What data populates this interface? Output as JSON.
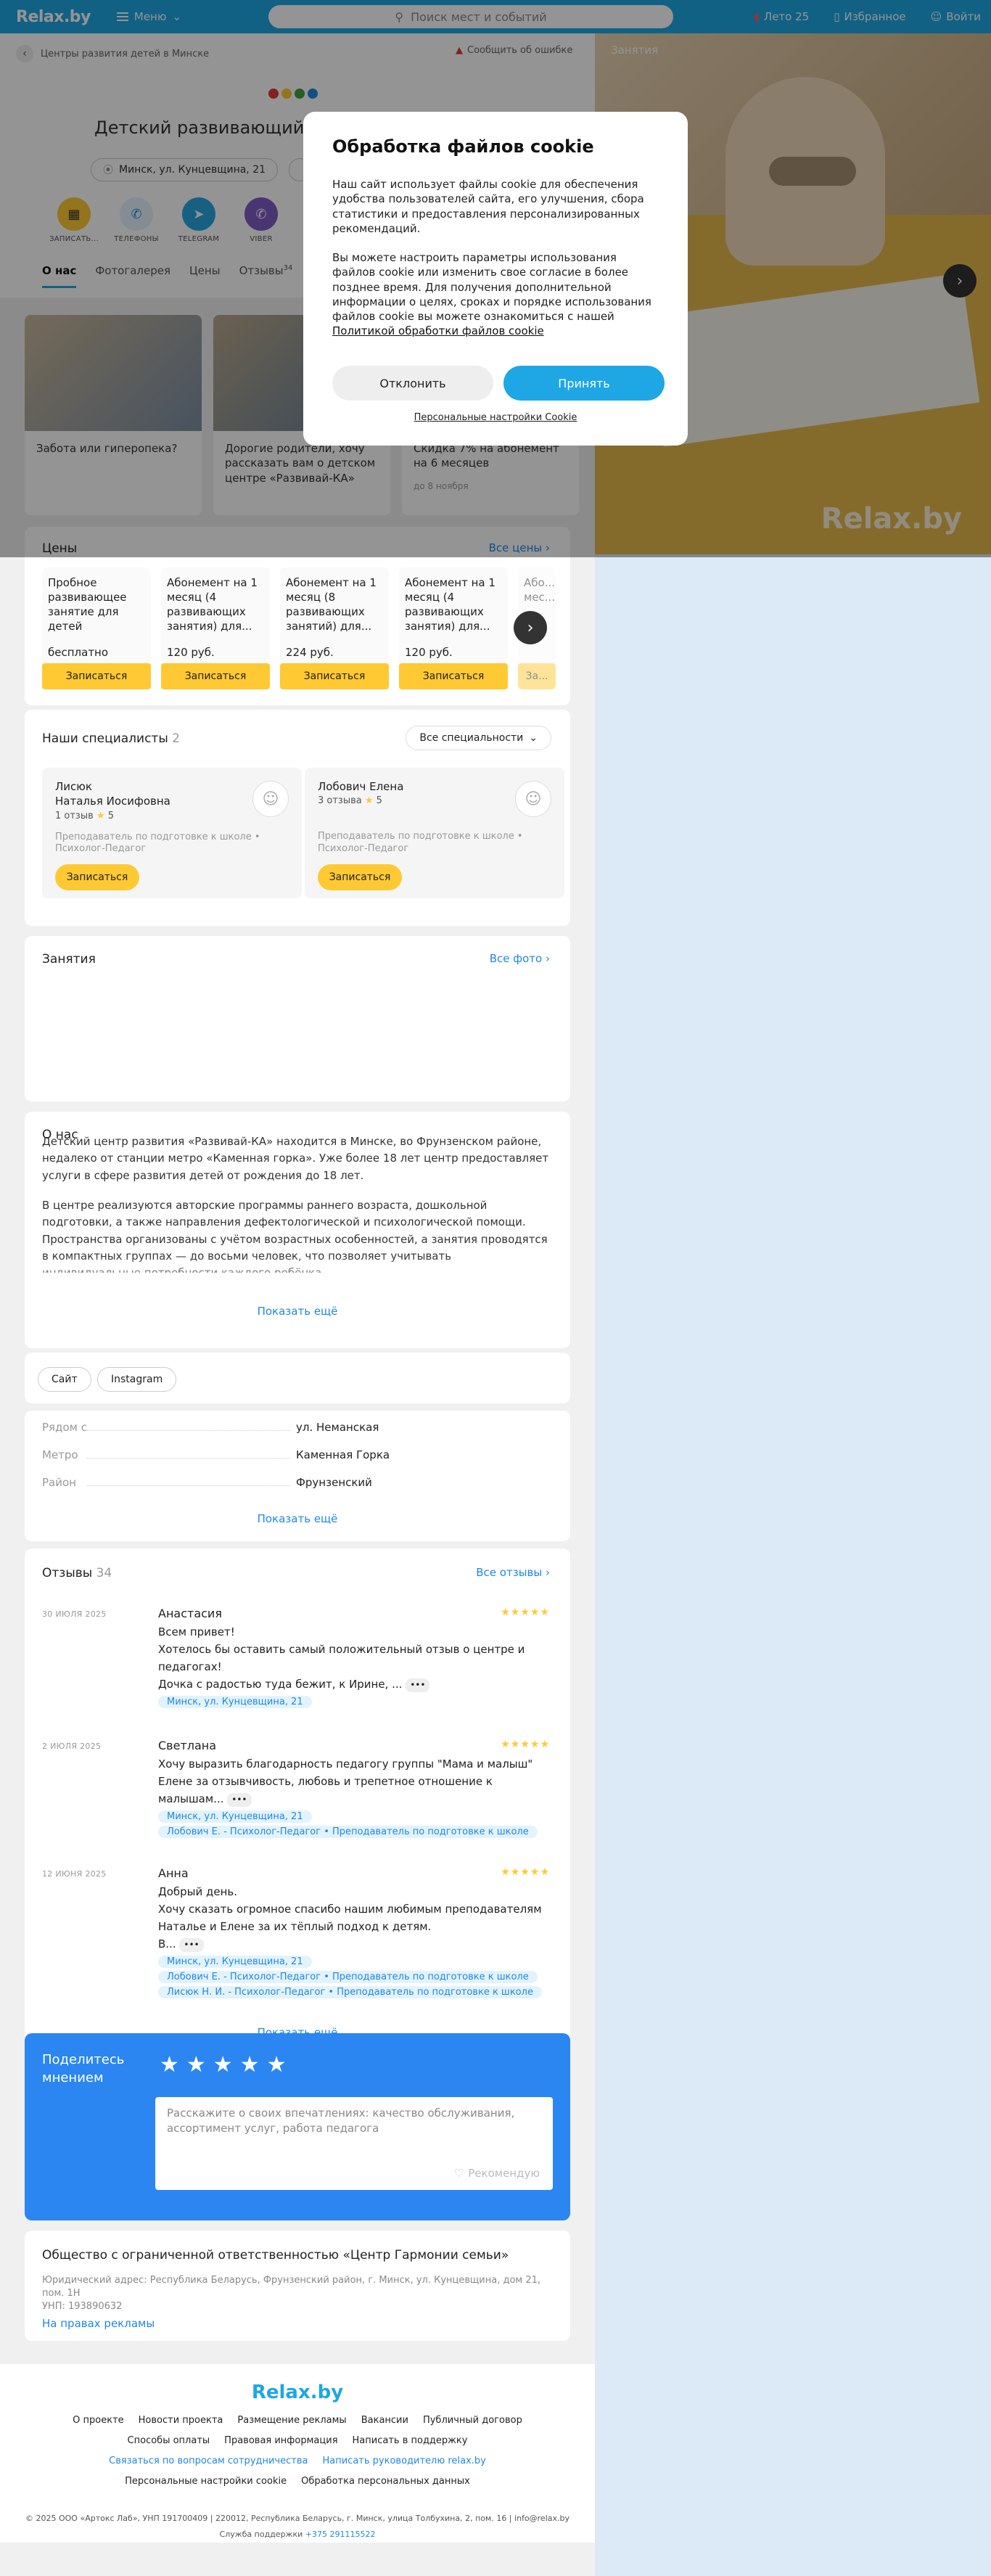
{
  "header": {
    "logo": "Relax.by",
    "menu": "Меню",
    "search_placeholder": "Поиск мест и событий",
    "summer": "Лето 25",
    "favorites": "Избранное",
    "login": "Войти"
  },
  "breadcrumb": "Центры развития детей в Минске",
  "report": "Сообщить об ошибке",
  "org": {
    "title": "Детский развивающий центр «Развивай-КА»",
    "address": "Минск, ул. Кунцевщина, 21"
  },
  "actions": [
    {
      "label": "ЗАПИСАТЬ...",
      "icon": "calendar-icon",
      "color": "#ffc933"
    },
    {
      "label": "ТЕЛЕФОНЫ",
      "icon": "phone-icon",
      "color": "#e3f3fd"
    },
    {
      "label": "TELEGRAM",
      "icon": "telegram-icon",
      "color": "#2aa5e0"
    },
    {
      "label": "VIBER",
      "icon": "viber-icon",
      "color": "#7c5cc4"
    }
  ],
  "tabs": [
    {
      "label": "О нас",
      "active": true
    },
    {
      "label": "Фотогалерея"
    },
    {
      "label": "Цены"
    },
    {
      "label": "Отзывы",
      "badge": "34"
    }
  ],
  "news": [
    {
      "title": "Забота или гиперопека?",
      "meta": ""
    },
    {
      "title": "Дорогие родители, хочу рассказать вам о детском центре «Развивай-КА»",
      "meta": ""
    },
    {
      "title": "Скидка 7% на абонемент на 6 месяцев",
      "meta": "до 8 ноября"
    }
  ],
  "prices": {
    "title": "Цены",
    "all": "Все цены",
    "items": [
      {
        "name": "Пробное развивающее занятие для детей",
        "price": "бесплатно",
        "button": "Записаться"
      },
      {
        "name": "Абонемент на 1 месяц (4 развивающих занятия) для...",
        "price": "120 руб.",
        "button": "Записаться"
      },
      {
        "name": "Абонемент на 1 месяц (8 развивающих занятий) для...",
        "price": "224 руб.",
        "button": "Записаться"
      },
      {
        "name": "Абонемент на 1 месяц (4 развивающих занятия) для...",
        "price": "120 руб.",
        "button": "Записаться"
      },
      {
        "name": "Або... мес...",
        "price": "",
        "button": "За..."
      }
    ]
  },
  "specialists": {
    "title": "Наши специалисты",
    "count": "2",
    "filter": "Все специальности",
    "items": [
      {
        "name1": "Лисюк",
        "name2": "Наталья Иосифовна",
        "reviews": "1 отзыв",
        "rating": "5",
        "role": "Преподаватель по подготовке к школе • Психолог-Педагог",
        "button": "Записаться"
      },
      {
        "name1": "Лобович Елена",
        "name2": "",
        "reviews": "3 отзыва",
        "rating": "5",
        "role": "Преподаватель по подготовке к школе • Психолог-Педагог",
        "button": "Записаться"
      }
    ]
  },
  "classes": {
    "title": "Занятия",
    "all": "Все фото"
  },
  "about": {
    "title": "О нас",
    "p1": "Детский центр развития «Развивай-КА» находится в Минске, во Фрунзенском районе, недалеко от станции метро «Каменная горка». Уже более 18 лет центр предоставляет услуги в сфере развития детей от рождения до 18 лет.",
    "p2": "В центре реализуются авторские программы раннего возраста, дошкольной подготовки, а также направления дефектологической и психологической помощи. Пространства организованы с учётом возрастных особенностей, а занятия проводятся в компактных группах — до восьми человек, что позволяет учитывать индивидуальные потребности каждого ребёнка.",
    "more": "Показать ещё"
  },
  "links": [
    "Сайт",
    "Instagram"
  ],
  "info": {
    "rows": [
      {
        "k": "Рядом с",
        "v": "ул. Неманская"
      },
      {
        "k": "Метро",
        "v": "Каменная Горка"
      },
      {
        "k": "Район",
        "v": "Фрунзенский"
      }
    ],
    "more": "Показать ещё"
  },
  "reviews": {
    "title": "Отзывы",
    "count": "34",
    "all": "Все отзывы",
    "more": "Показать ещё",
    "items": [
      {
        "date": "30 ИЮЛЯ 2025",
        "name": "Анастасия",
        "stars": "★★★★★",
        "lines": [
          "Всем привет!",
          "Хотелось бы оставить самый положительный отзыв о центре и педагогах!",
          "Дочка с радостью туда бежит, к Ирине, ..."
        ],
        "tags": [
          "Минск, ул. Кунцевщина, 21"
        ]
      },
      {
        "date": "2 ИЮЛЯ 2025",
        "name": "Светлана",
        "stars": "★★★★★",
        "lines": [
          "Хочу выразить благодарность педагогу группы \"Мама и малыш\" Елене за отзывчивость, любовь и трепетное отношение к малышам..."
        ],
        "tags": [
          "Минск, ул. Кунцевщина, 21",
          "Лобович Е. - Психолог-Педагог • Преподаватель по подготовке к школе"
        ]
      },
      {
        "date": "12 ИЮНЯ 2025",
        "name": "Анна",
        "stars": "★★★★★",
        "lines": [
          "Добрый день.",
          "Хочу сказать огромное спасибо нашим любимым преподавателям Наталье и Елене за их тёплый подход к детям.",
          "В..."
        ],
        "tags": [
          "Минск, ул. Кунцевщина, 21",
          "Лобович Е. - Психолог-Педагог • Преподаватель по подготовке к школе",
          "Лисюк Н. И. - Психолог-Педагог • Преподаватель по подготовке к школе"
        ]
      }
    ]
  },
  "share": {
    "title": "Поделитесь мнением",
    "stars": "★★★★★",
    "placeholder": "Расскажите о своих впечатлениях: качество обслуживания, ассортимент услуг, работа педагога",
    "recommend": "Рекомендую"
  },
  "company": {
    "name": "Общество с ограниченной ответственностью «Центр Гармонии семьи»",
    "address": "Юридический адрес: Республика Беларусь, Фрунзенский район, г. Минск, ул. Кунцевщина, дом 21, пом. 1Н",
    "unp": "УНП: 193890632",
    "ad": "На правах рекламы"
  },
  "footer": {
    "logo": "Relax.by",
    "row1": [
      "О проекте",
      "Новости проекта",
      "Размещение рекламы",
      "Вакансии",
      "Публичный договор"
    ],
    "row2": [
      "Способы оплаты",
      "Правовая информация",
      "Написать в поддержку"
    ],
    "row3": [
      "Связаться по вопросам сотрудничества",
      "Написать руководителю relax.by"
    ],
    "row4": [
      "Персональные настройки cookie",
      "Обработка персональных данных"
    ],
    "copyright": "© 2025 ООО «Артокс Лаб», УНП 191700409 | 220012, Республика Беларусь, г. Минск, улица Толбухина, 2, пом. 16 | info@relax.by",
    "support_label": "Служба поддержки",
    "support_phone": "+375 291115522"
  },
  "gallery": {
    "label": "Занятия",
    "watermark": "Relax.by"
  },
  "cookie": {
    "title": "Обработка файлов cookie",
    "p1": "Наш сайт использует файлы cookie для обеспечения удобства пользователей сайта, его улучшения, сбора статистики и предоставления персонализированных рекомендаций.",
    "p2": "Вы можете настроить параметры использования файлов cookie или изменить свое согласие в более позднее время. Для получения дополнительной информации о целях, сроках и порядке использования файлов cookie вы можете ознакомиться с нашей",
    "policy": "Политикой обработки файлов cookie",
    "decline": "Отклонить",
    "accept": "Принять",
    "settings": "Персональные настройки Cookie"
  }
}
